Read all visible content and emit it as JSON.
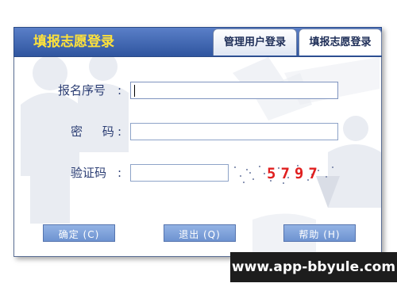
{
  "header": {
    "title": "填报志愿登录"
  },
  "tabs": [
    {
      "label": "管理用户登录"
    },
    {
      "label": "填报志愿登录"
    }
  ],
  "form": {
    "serial": {
      "label": "报名序号",
      "colon": ":",
      "value": ""
    },
    "password": {
      "label": "密 码",
      "colon": ":",
      "value": ""
    },
    "captcha": {
      "label": "验证码",
      "colon": ":",
      "value": "",
      "code": "5797"
    }
  },
  "buttons": {
    "ok": "确定 (C)",
    "quit": "退出 (Q)",
    "help": "帮助 (H)"
  },
  "watermark": "www.app-bbyule.com",
  "colors": {
    "header_bg": "#2f559f",
    "header_title": "#ffe23a",
    "label": "#2c3e74",
    "captcha_code": "#e02020",
    "button_bg": "#7fa1da"
  }
}
